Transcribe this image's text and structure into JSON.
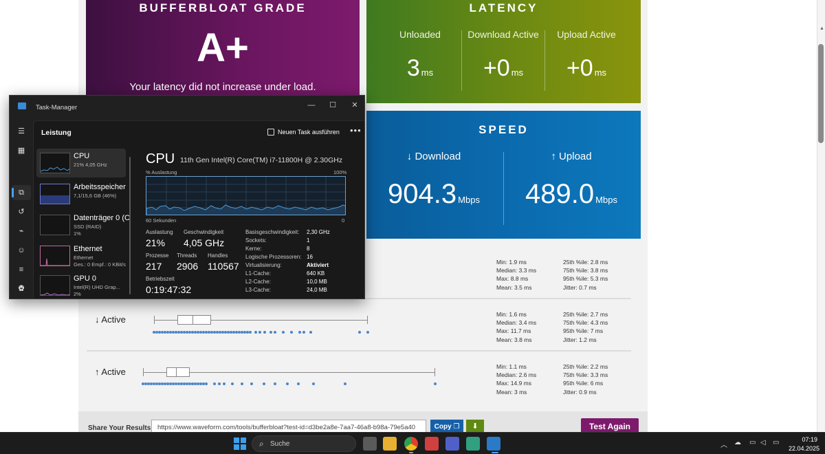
{
  "grade": {
    "title": "BUFFERBLOAT GRADE",
    "value": "A+",
    "description": "Your latency did not increase under load."
  },
  "latency": {
    "title": "LATENCY",
    "columns": [
      {
        "label": "Unloaded",
        "value": "3",
        "unit": "ms"
      },
      {
        "label": "Download Active",
        "value": "+0",
        "unit": "ms"
      },
      {
        "label": "Upload Active",
        "value": "+0",
        "unit": "ms"
      }
    ]
  },
  "speed": {
    "title": "SPEED",
    "download": {
      "label": "↓ Download",
      "value": "904.3",
      "unit": "Mbps"
    },
    "upload": {
      "label": "↑ Upload",
      "value": "489.0",
      "unit": "Mbps"
    }
  },
  "latency_rows": [
    {
      "label": "",
      "stats_left": [
        "Min: 1.9 ms",
        "Median: 3.3 ms",
        "Max: 8.8 ms",
        "Mean: 3.5 ms"
      ],
      "stats_right": [
        "25th %ile: 2.8 ms",
        "75th %ile: 3.8 ms",
        "95th %ile: 5.3 ms",
        "Jitter: 0.7 ms"
      ]
    },
    {
      "label": "↓ Active",
      "stats_left": [
        "Min: 1.6 ms",
        "Median: 3.4 ms",
        "Max: 11.7 ms",
        "Mean: 3.8 ms"
      ],
      "stats_right": [
        "25th %ile: 2.7 ms",
        "75th %ile: 4.3 ms",
        "95th %ile: 7 ms",
        "Jitter: 1.2 ms"
      ]
    },
    {
      "label": "↑ Active",
      "stats_left": [
        "Min: 1.1 ms",
        "Median: 2.6 ms",
        "Max: 14.9 ms",
        "Mean: 3 ms"
      ],
      "stats_right": [
        "25th %ile: 2.2 ms",
        "75th %ile: 3.3 ms",
        "95th %ile: 6 ms",
        "Jitter: 0.9 ms"
      ]
    }
  ],
  "share": {
    "label": "Share Your Results:",
    "url": "https://www.waveform.com/tools/bufferbloat?test-id=d3be2a8e-7aa7-46a8-b98a-79e5a40",
    "copy_label": "Copy",
    "test_again_label": "Test Again"
  },
  "task_manager": {
    "window_title": "Task-Manager",
    "section_title": "Leistung",
    "new_task_label": "Neuen Task ausführen",
    "devices": [
      {
        "name": "CPU",
        "sub1": "21% 4,05 GHz",
        "sub2": ""
      },
      {
        "name": "Arbeitsspeicher",
        "sub1": "7,1/15,6 GB (46%)",
        "sub2": ""
      },
      {
        "name": "Datenträger 0 (C",
        "sub1": "SSD (RAID)",
        "sub2": "1%"
      },
      {
        "name": "Ethernet",
        "sub1": "Ethernet",
        "sub2": "Ges.: 0 Empf.: 0 KBit/s"
      },
      {
        "name": "GPU 0",
        "sub1": "Intel(R) UHD Grap...",
        "sub2": "2%"
      }
    ],
    "cpu": {
      "title": "CPU",
      "model": "11th Gen Intel(R) Core(TM) i7-11800H @ 2.30GHz",
      "graph_top_left": "% Auslastung",
      "graph_top_right": "100%",
      "graph_bottom_left": "60 Sekunden",
      "graph_bottom_right": "0",
      "utilization_label": "Auslastung",
      "utilization": "21%",
      "speed_label": "Geschwindigkeit",
      "speed": "4,05 GHz",
      "processes_label": "Prozesse",
      "processes": "217",
      "threads_label": "Threads",
      "threads": "2906",
      "handles_label": "Handles",
      "handles": "110567",
      "uptime_label": "Betriebszeit",
      "uptime": "0:19:47:32",
      "specs": [
        {
          "k": "Basisgeschwindigkeit:",
          "v": "2,30 GHz"
        },
        {
          "k": "Sockets:",
          "v": "1"
        },
        {
          "k": "Kerne:",
          "v": "8"
        },
        {
          "k": "Logische Prozessoren:",
          "v": "16"
        },
        {
          "k": "Virtualisierung:",
          "v": "Aktiviert"
        },
        {
          "k": "L1-Cache:",
          "v": "640 KB"
        },
        {
          "k": "L2-Cache:",
          "v": "10,0 MB"
        },
        {
          "k": "L3-Cache:",
          "v": "24,0 MB"
        }
      ]
    }
  },
  "taskbar": {
    "search_placeholder": "Suche",
    "time": "07:19",
    "date": "22.04.2025"
  },
  "colors": {
    "grade_bg": "#6b1660",
    "latency_bg": "#6d8a12",
    "speed_bg": "#0b6aae",
    "dot_blue": "#4a86c8",
    "accent_blue": "#4ca0f0"
  }
}
